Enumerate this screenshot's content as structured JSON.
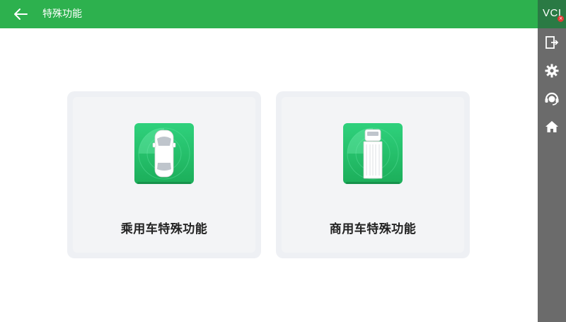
{
  "header": {
    "title": "特殊功能",
    "back_icon": "arrow-left-icon"
  },
  "siderail": {
    "vci_label": "VCI",
    "vci_badge": "×",
    "items": [
      {
        "icon": "exit-icon"
      },
      {
        "icon": "gear-icon"
      },
      {
        "icon": "headset-support-icon"
      },
      {
        "icon": "home-icon"
      }
    ]
  },
  "cards": [
    {
      "label": "乘用车特殊功能",
      "icon": "passenger-car-icon"
    },
    {
      "label": "商用车特殊功能",
      "icon": "commercial-truck-icon"
    }
  ],
  "colors": {
    "accent": "#2db14e",
    "rail": "#6b6b6b",
    "vci": "#2a7a44",
    "card_bg": "#eef0f4"
  }
}
